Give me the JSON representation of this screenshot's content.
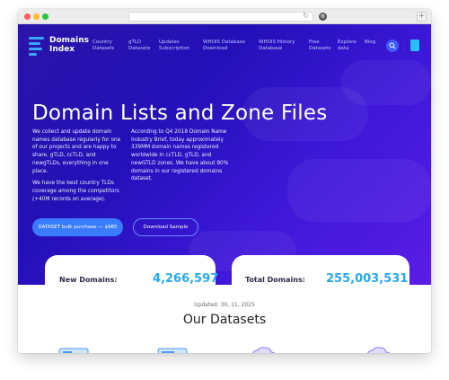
{
  "browser": {
    "reload_glyph": "↻",
    "extension_glyph": "⚙",
    "new_tab_glyph": "+"
  },
  "nav": {
    "logo_line1": "Domains",
    "logo_line2": "Index",
    "items": [
      {
        "line1": "Country",
        "line2": "Datasets"
      },
      {
        "line1": "gTLD",
        "line2": "Datasets"
      },
      {
        "line1": "Updates",
        "line2": "Subscription"
      },
      {
        "line1": "WHOIS Database",
        "line2": "Download"
      },
      {
        "line1": "WHOIS History",
        "line2": "Database"
      },
      {
        "line1": "Free",
        "line2": "Datasets"
      },
      {
        "line1": "Explore",
        "line2": "data"
      },
      {
        "line1": "Blog",
        "line2": ""
      }
    ],
    "search_icon": "search-icon",
    "cart_icon": "cart-icon"
  },
  "hero": {
    "title": "Domain Lists and Zone Files",
    "left_paragraphs": [
      "We collect and update domain names database regularly for one of our projects and are happy to share. gTLD, ccTLD, and newgTLDs, everything in one place.",
      "We have the best country TLDs coverage among the competitors (+40M records on average)."
    ],
    "right_paragraph": "According to Q4 2018 Domain Name Industry Brief, today approximately 339MM domain names registered worldwide in ccTLD, gTLD, and newGTLD zones. We have about 80% domains in our registered domains dataset.",
    "primary_button": "DATASET bulk purchase — $985",
    "secondary_button": "Download Sample"
  },
  "stats": {
    "new_label": "New Domains:",
    "new_value": "4,266,597",
    "total_label": "Total Domains:",
    "total_value": "255,003,531"
  },
  "updated": "Updated: 30, 11, 2025",
  "section_title": "Our Datasets",
  "colors": {
    "hero_start": "#2a14a8",
    "hero_end": "#5a1de6",
    "accent_blue": "#27a9f0",
    "button_blue": "#3a7cff"
  }
}
